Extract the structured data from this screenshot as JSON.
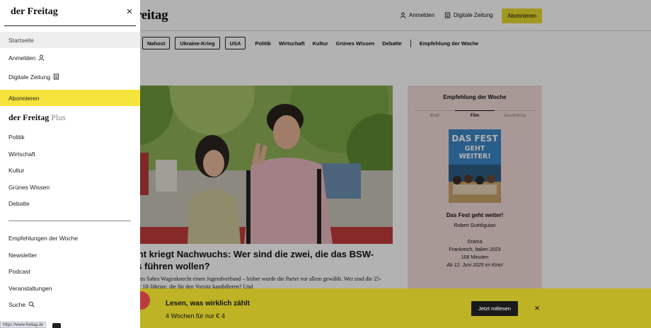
{
  "header": {
    "logo": "der Freitag",
    "login": "Anmelden",
    "digital": "Digitale Zeitung",
    "subscribe": "Abonnieren"
  },
  "nav": {
    "tags": [
      "Nahost",
      "Ukraine-Krieg",
      "USA"
    ],
    "links": [
      "Politik",
      "Wirtschaft",
      "Kultur",
      "Grünes Wissen",
      "Debatte"
    ],
    "extra": "Empfehlung der Woche"
  },
  "article": {
    "headline_line1": "enknecht kriegt Nachwuchs: Wer sind die zwei, die das BSW-",
    "headline_line2": "bündnis führen wollen?",
    "teaser": "ndet das Bündnis Sahra Wagenknecht einen Jugendverband – bisher wurde die Partei vor allem gewählt. Wer sind die 25-Jährige und der 18-Jährige, die für den Vorsitz kandidieren? Und"
  },
  "recommendation": {
    "title": "Empfehlung der Woche",
    "tabs": [
      "Buch",
      "Film",
      "Ausstellung"
    ],
    "active_tab": "Film",
    "poster_line1": "DAS FEST",
    "poster_line2": "GEHT WEITER!",
    "film_title": "Das Fest geht weiter!",
    "director": "Robert Guédiguian",
    "genre": "Drama",
    "country": "Frankreich, Italien 2023",
    "duration": "106 Minuten",
    "release": "Ab 12. Juni 2025 im Kino!"
  },
  "banner": {
    "headline": "Lesen, was wirklich zählt",
    "subline": "4 Wochen für nur € 4",
    "button": "Jetzt mitlesen"
  },
  "drawer": {
    "logo": "der Freitag",
    "items": {
      "home": "Startseite",
      "login": "Anmelden",
      "digital": "Digitale Zeitung",
      "subscribe": "Abonnieren"
    },
    "plus_logo": "der Freitag",
    "plus_suffix": "Plus",
    "sections": [
      "Politik",
      "Wirtschaft",
      "Kultur",
      "Grünes Wissen",
      "Debatte"
    ],
    "more": [
      "Empfehlungen der Woche",
      "Newsletter",
      "Podcast",
      "Veranstaltungen",
      "Suche"
    ]
  },
  "status_url": "https://www.freitag.de",
  "colors": {
    "accent_yellow": "#e8da2e",
    "drawer_highlight": "#f6e33c",
    "recommendation_bg": "#f1dcd8"
  }
}
